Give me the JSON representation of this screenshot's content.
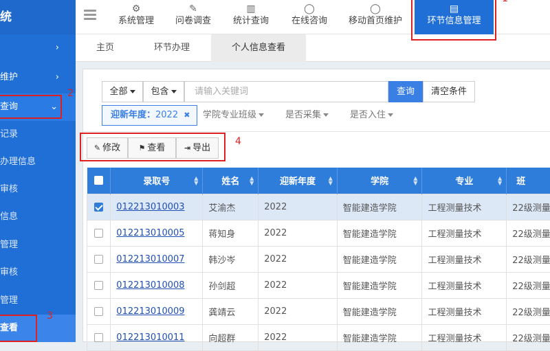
{
  "sidebar": {
    "brand": "统",
    "items": [
      {
        "label": "",
        "arrow": "›"
      },
      {
        "label": "维护",
        "arrow": "›"
      },
      {
        "label": "查询",
        "arrow": "⌄"
      },
      {
        "label": "记录"
      },
      {
        "label": "办理信息"
      },
      {
        "label": "审核"
      },
      {
        "label": "信息"
      },
      {
        "label": "管理"
      },
      {
        "label": "审核"
      },
      {
        "label": "管理"
      },
      {
        "label": "查看"
      }
    ]
  },
  "topnav": {
    "items": [
      {
        "label": "系统管理",
        "icon": "⚙"
      },
      {
        "label": "问卷调查",
        "icon": "✎"
      },
      {
        "label": "统计查询",
        "icon": "▥"
      },
      {
        "label": "在线咨询",
        "icon": "◯"
      },
      {
        "label": "移动首页维护",
        "icon": "◯"
      },
      {
        "label": "环节信息管理",
        "icon": "▤"
      }
    ]
  },
  "tabs": [
    "主页",
    "环节办理",
    "个人信息查看"
  ],
  "filter": {
    "scope": "全部",
    "match": "包含",
    "placeholder": "请输入关键词",
    "search": "查询",
    "clear": "清空条件",
    "tag_label": "迎新年度：",
    "tag_value": "2022",
    "tag_close": "✖",
    "dropdowns": [
      "学院专业班级",
      "是否采集",
      "是否入住"
    ]
  },
  "toolbar": {
    "edit": "修改",
    "view": "查看",
    "export": "导出"
  },
  "table": {
    "headers": [
      "录取号",
      "姓名",
      "迎新年度",
      "学院",
      "专业",
      "班"
    ],
    "rows": [
      {
        "id": "012213010003",
        "name": "艾渝杰",
        "year": "2022",
        "college": "智能建造学院",
        "major": "工程测量技术",
        "cls": "22级测量",
        "checked": true
      },
      {
        "id": "012213010005",
        "name": "蒋知身",
        "year": "2022",
        "college": "智能建造学院",
        "major": "工程测量技术",
        "cls": "22级测量",
        "checked": false
      },
      {
        "id": "012213010007",
        "name": "韩沙岑",
        "year": "2022",
        "college": "智能建造学院",
        "major": "工程测量技术",
        "cls": "22级测量",
        "checked": false
      },
      {
        "id": "012213010008",
        "name": "孙剑超",
        "year": "2022",
        "college": "智能建造学院",
        "major": "工程测量技术",
        "cls": "22级测量",
        "checked": false
      },
      {
        "id": "012213010009",
        "name": "龚靖云",
        "year": "2022",
        "college": "智能建造学院",
        "major": "工程测量技术",
        "cls": "22级测量",
        "checked": false
      },
      {
        "id": "012213010011",
        "name": "向超群",
        "year": "2022",
        "college": "智能建造学院",
        "major": "工程测量技术",
        "cls": "22级测量",
        "checked": false
      }
    ]
  },
  "annotations": [
    "1",
    "2",
    "3",
    "4"
  ],
  "colors": {
    "primary": "#1f6fd6",
    "header": "#2f7ddb",
    "annotation": "#e02020"
  }
}
